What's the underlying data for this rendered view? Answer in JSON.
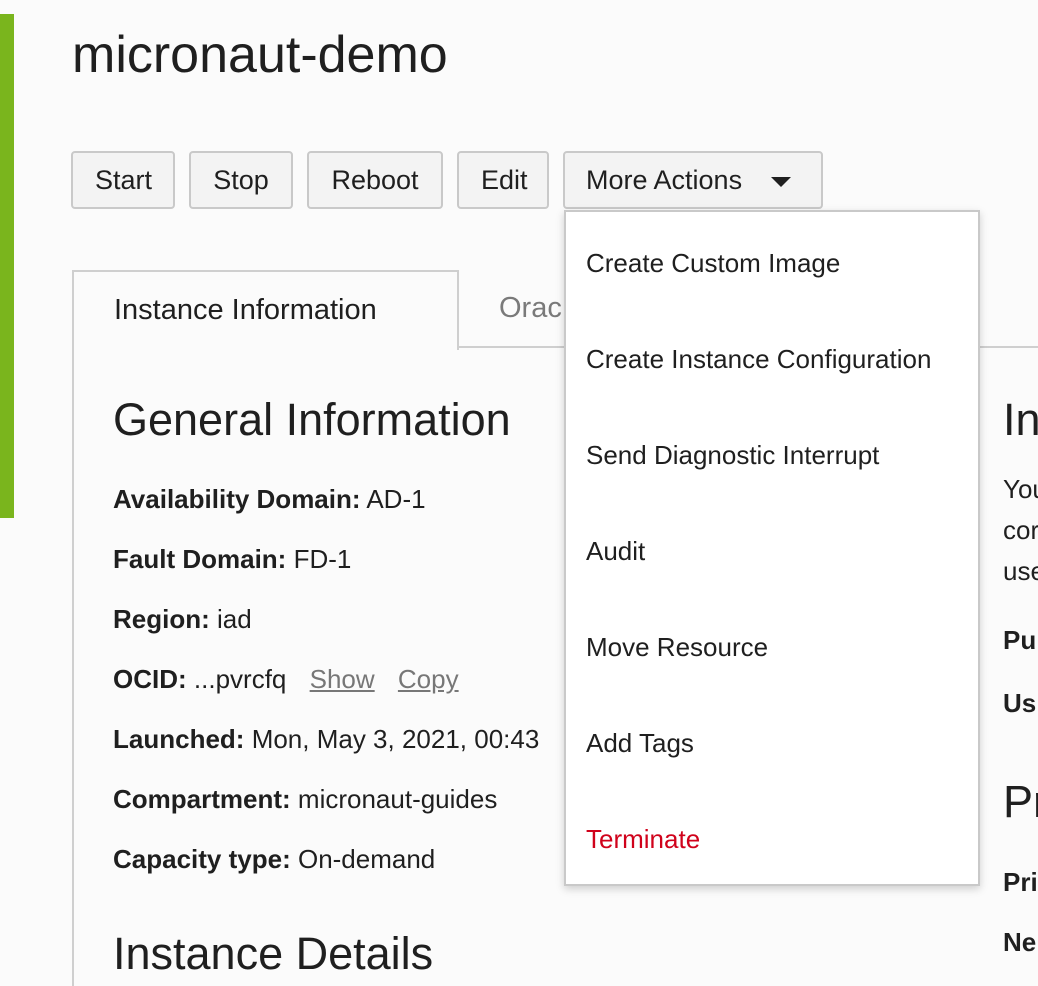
{
  "page": {
    "title": "micronaut-demo",
    "accent_color": "#7ab51d"
  },
  "toolbar": {
    "start_label": "Start",
    "stop_label": "Stop",
    "reboot_label": "Reboot",
    "edit_label": "Edit",
    "more_actions_label": "More Actions"
  },
  "tabs": [
    {
      "label": "Instance Information",
      "active": true
    },
    {
      "label": "Orac",
      "active": false
    }
  ],
  "general_info": {
    "heading": "General Information",
    "availability_domain": {
      "label": "Availability Domain:",
      "value": "AD-1"
    },
    "fault_domain": {
      "label": "Fault Domain:",
      "value": "FD-1"
    },
    "region": {
      "label": "Region:",
      "value": "iad"
    },
    "ocid": {
      "label": "OCID:",
      "value": "...pvrcfq",
      "show_link": "Show",
      "copy_link": "Copy"
    },
    "launched": {
      "label": "Launched:",
      "value": "Mon, May 3, 2021, 00:43"
    },
    "compartment": {
      "label": "Compartment:",
      "value": "micronaut-guides"
    },
    "capacity_type": {
      "label": "Capacity type:",
      "value": "On-demand"
    }
  },
  "instance_details": {
    "heading": "Instance Details"
  },
  "right_column": {
    "heading_1": "In",
    "text_lines": [
      "You",
      "cor",
      "use"
    ],
    "label_1": "Pu",
    "label_2": "Us",
    "heading_2": "Pr",
    "label_3": "Pri",
    "label_4": "Ne"
  },
  "more_actions_menu": {
    "items": [
      {
        "label": "Create Custom Image",
        "danger": false
      },
      {
        "label": "Create Instance Configuration",
        "danger": false
      },
      {
        "label": "Send Diagnostic Interrupt",
        "danger": false
      },
      {
        "label": "Audit",
        "danger": false
      },
      {
        "label": "Move Resource",
        "danger": false
      },
      {
        "label": "Add Tags",
        "danger": false
      },
      {
        "label": "Terminate",
        "danger": true
      }
    ],
    "danger_color": "#d0021b"
  }
}
